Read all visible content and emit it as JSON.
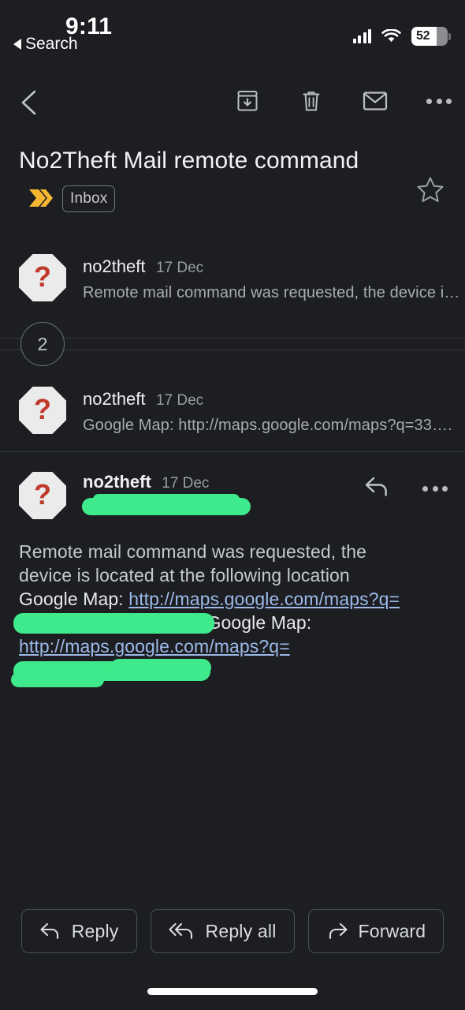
{
  "status_bar": {
    "time": "9:11",
    "back_label": "Search",
    "battery_percent": "52",
    "signal_icon": "cellular-signal-icon",
    "wifi_icon": "wifi-icon",
    "battery_icon": "battery-icon"
  },
  "toolbar": {
    "back_icon": "back-chevron-icon",
    "archive_icon": "archive-box-icon",
    "delete_icon": "trash-icon",
    "unread_icon": "envelope-icon",
    "more_icon": "more-dots-icon"
  },
  "subject": {
    "text": "No2Theft Mail remote command",
    "marker_icon": "double-chevron-marker-icon",
    "marker_color": "#f5b731",
    "label": "Inbox",
    "star_icon": "star-outline-icon"
  },
  "thread": {
    "collapsed_count": "2",
    "messages": [
      {
        "sender": "no2theft",
        "date": "17 Dec",
        "preview": "Remote mail command was requested, the device i…",
        "avatar_icon": "question-mark-octagon-avatar"
      },
      {
        "sender": "no2theft",
        "date": "17 Dec",
        "preview": "Google Map: http://maps.google.com/maps?q=33….",
        "avatar_icon": "question-mark-octagon-avatar"
      }
    ],
    "expanded": {
      "sender": "no2theft",
      "date": "17 Dec",
      "avatar_icon": "question-mark-octagon-avatar",
      "reply_icon": "reply-arrow-icon",
      "more_icon": "more-dots-icon",
      "recipient_redacted": true,
      "body": {
        "line1": "Remote mail command was requested, the",
        "line2": "device is located at the following location",
        "label1": "Google Map:",
        "link1": "http://maps.google.com/maps?q=",
        "label2": "Google Map:",
        "link2": "http://maps.google.com/maps?q="
      }
    }
  },
  "actions": {
    "reply": "Reply",
    "reply_all": "Reply all",
    "forward": "Forward",
    "reply_icon": "reply-arrow-icon",
    "reply_all_icon": "reply-all-arrow-icon",
    "forward_icon": "forward-arrow-icon"
  },
  "colors": {
    "background": "#1c1e21",
    "redaction": "#3eea8b",
    "link": "#9cb9e9",
    "accent_marker": "#f5b731"
  }
}
